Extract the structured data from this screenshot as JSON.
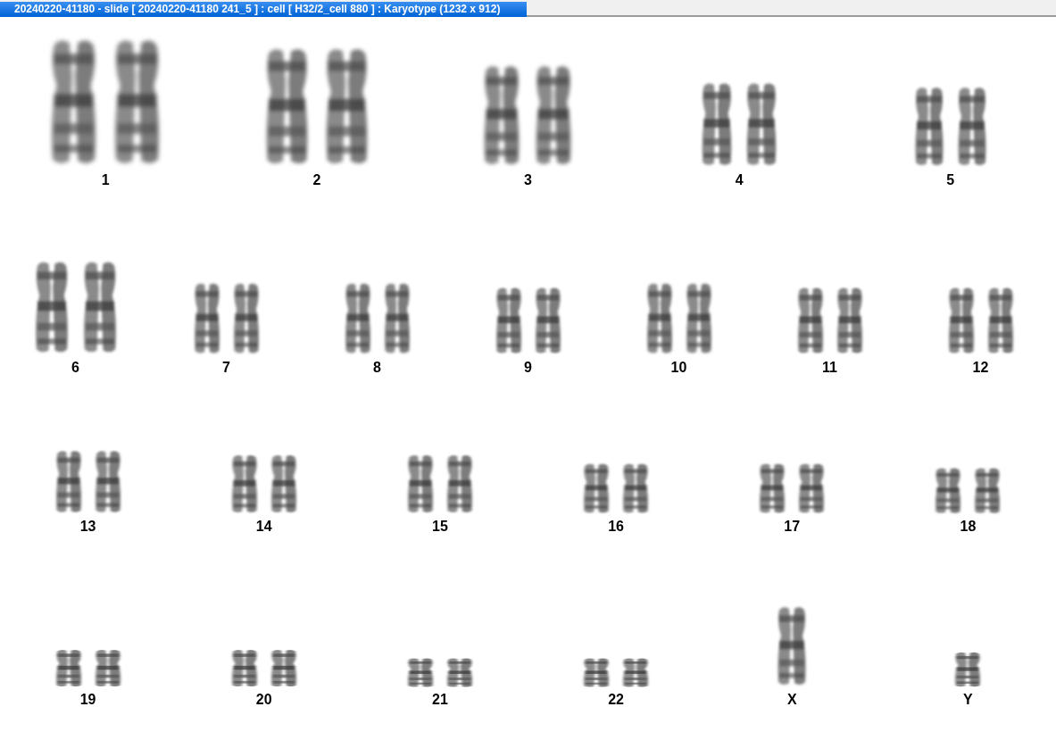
{
  "window": {
    "title": "20240220-41180 - slide [ 20240220-41180 241_5 ] : cell [ H32/2_cell 880 ] : Karyotype  (1232 x 912)"
  },
  "karyotype": {
    "rows": [
      {
        "groups": [
          {
            "label": "1",
            "kind": "pair"
          },
          {
            "label": "2",
            "kind": "pair"
          },
          {
            "label": "3",
            "kind": "pair"
          },
          {
            "label": "4",
            "kind": "pair"
          },
          {
            "label": "5",
            "kind": "pair"
          }
        ]
      },
      {
        "groups": [
          {
            "label": "6",
            "kind": "pair"
          },
          {
            "label": "7",
            "kind": "pair"
          },
          {
            "label": "8",
            "kind": "pair"
          },
          {
            "label": "9",
            "kind": "pair"
          },
          {
            "label": "10",
            "kind": "pair"
          },
          {
            "label": "11",
            "kind": "pair"
          },
          {
            "label": "12",
            "kind": "pair"
          }
        ]
      },
      {
        "groups": [
          {
            "label": "13",
            "kind": "pair"
          },
          {
            "label": "14",
            "kind": "pair"
          },
          {
            "label": "15",
            "kind": "pair"
          },
          {
            "label": "16",
            "kind": "pair"
          },
          {
            "label": "17",
            "kind": "pair"
          },
          {
            "label": "18",
            "kind": "pair"
          }
        ]
      },
      {
        "groups": [
          {
            "label": "19",
            "kind": "pair"
          },
          {
            "label": "20",
            "kind": "pair"
          },
          {
            "label": "21",
            "kind": "pair"
          },
          {
            "label": "22",
            "kind": "pair"
          },
          {
            "label": "X",
            "kind": "single"
          },
          {
            "label": "Y",
            "kind": "single"
          }
        ]
      }
    ]
  }
}
